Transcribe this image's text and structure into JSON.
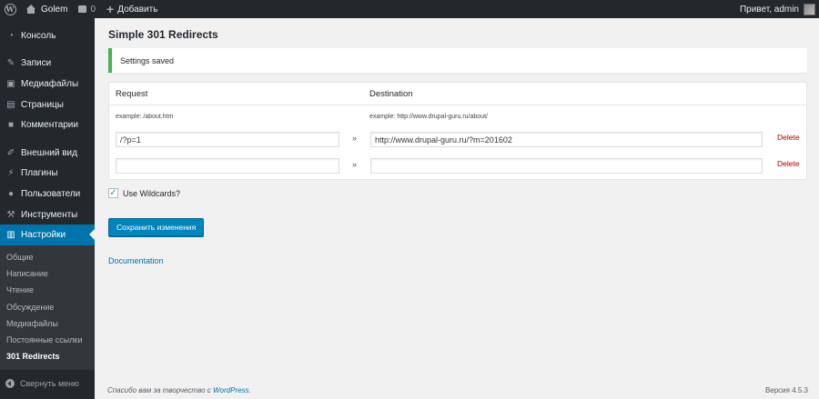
{
  "adminbar": {
    "site_name": "Golem",
    "comments_count": "0",
    "new_label": "Добавить",
    "greeting": "Привет, admin"
  },
  "sidebar": {
    "items": [
      {
        "label": "Консоль",
        "icon": "dashboard-icon"
      },
      {
        "label": "Записи",
        "icon": "pin-icon"
      },
      {
        "label": "Медиафайлы",
        "icon": "media-icon"
      },
      {
        "label": "Страницы",
        "icon": "pages-icon"
      },
      {
        "label": "Комментарии",
        "icon": "comments-icon"
      },
      {
        "label": "Внешний вид",
        "icon": "brush-icon"
      },
      {
        "label": "Плагины",
        "icon": "plugin-icon"
      },
      {
        "label": "Пользователи",
        "icon": "user-icon"
      },
      {
        "label": "Инструменты",
        "icon": "wrench-icon"
      },
      {
        "label": "Настройки",
        "icon": "settings-icon"
      }
    ],
    "submenu": [
      "Общие",
      "Написание",
      "Чтение",
      "Обсуждение",
      "Медиафайлы",
      "Постоянные ссылки",
      "301 Redirects"
    ],
    "collapse_label": "Свернуть меню"
  },
  "main": {
    "title": "Simple 301 Redirects",
    "notice": "Settings saved",
    "columns": {
      "request": "Request",
      "destination": "Destination"
    },
    "examples": {
      "request": "example: /about.htm",
      "destination": "example: http://www.drupal-guru.ru/about/"
    },
    "rows": [
      {
        "request": "/?p=1",
        "destination": "http://www.drupal-guru.ru/?m=201602",
        "delete": "Delete"
      },
      {
        "request": "",
        "destination": "",
        "delete": "Delete"
      }
    ],
    "arrow": "»",
    "wildcards_label": "Use Wildcards?",
    "wildcards_checked": true,
    "save_label": "Сохранить изменения",
    "documentation_label": "Documentation"
  },
  "footer": {
    "thanks_prefix": "Спасибо вам за творчество с ",
    "thanks_link": "WordPress",
    "thanks_suffix": ".",
    "version": "Версия 4.5.3"
  },
  "colors": {
    "adminbar_bg": "#23282d",
    "accent": "#0073aa",
    "notice_border": "#46b450",
    "delete": "#a00"
  }
}
